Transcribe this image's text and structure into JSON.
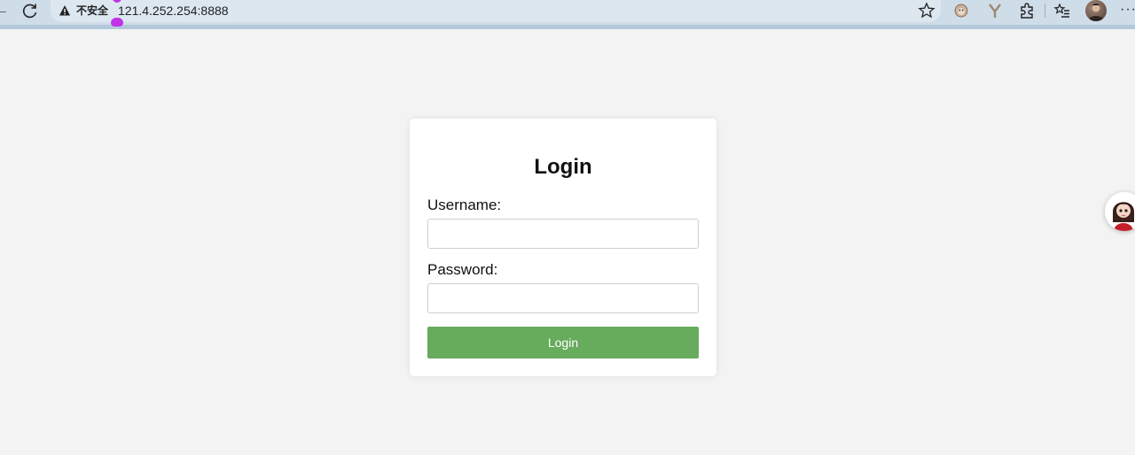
{
  "browser": {
    "security_label": "不安全",
    "url": "121.4.252.254:8888",
    "icons": [
      "back-arrow-icon",
      "reload-icon",
      "warning-icon",
      "star-icon",
      "extension-icon",
      "favorites-icon",
      "profile-avatar",
      "more-icon"
    ]
  },
  "login": {
    "title": "Login",
    "username_label": "Username:",
    "username_value": "",
    "password_label": "Password:",
    "password_value": "",
    "submit_label": "Login",
    "accent_color": "#67ab5d"
  }
}
